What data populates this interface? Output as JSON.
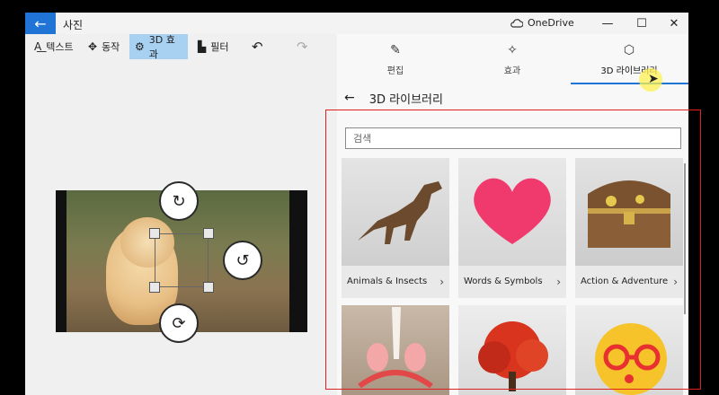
{
  "titlebar": {
    "back_icon": "←",
    "app_title": "사진",
    "onedrive_label": "OneDrive",
    "minimize_icon": "—",
    "maximize_icon": "☐",
    "close_icon": "✕"
  },
  "toolbar": {
    "items": [
      {
        "icon": "A͟",
        "label": "텍스트"
      },
      {
        "icon": "✥",
        "label": "동작"
      },
      {
        "icon": "⚙",
        "label": "3D 효과"
      },
      {
        "icon": "▙",
        "label": "필터"
      }
    ],
    "undo_icon": "↶",
    "redo_icon": "↷"
  },
  "tabs": [
    {
      "icon": "✎",
      "label": "편집"
    },
    {
      "icon": "✧",
      "label": "효과"
    },
    {
      "icon": "⬡",
      "label": "3D 라이브러리"
    }
  ],
  "library": {
    "back_icon": "←",
    "title": "3D 라이브러리",
    "search_placeholder": "검색",
    "cards": [
      {
        "label": "Animals & Insects",
        "icon": "dinosaur-model"
      },
      {
        "label": "Words & Symbols",
        "icon": "heart-model"
      },
      {
        "label": "Action & Adventure",
        "icon": "treasure-chest-model"
      },
      {
        "label": "",
        "icon": "unicorn-horn-model"
      },
      {
        "label": "",
        "icon": "red-tree-model"
      },
      {
        "label": "",
        "icon": "emoji-glasses-model"
      }
    ],
    "chevron": "›"
  },
  "colors": {
    "accent": "#1f74d6",
    "active_tool": "#a8d0f0",
    "highlight_box": "#e02020"
  }
}
